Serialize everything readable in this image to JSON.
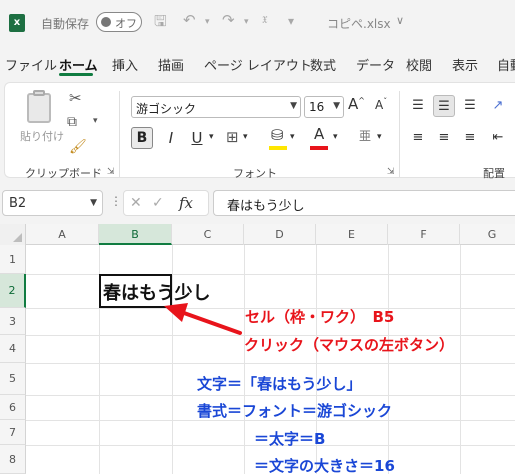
{
  "titlebar": {
    "autosave_label": "自動保存",
    "toggle_state": "オフ",
    "filename": "コピペ.xlsx",
    "filename_chevron": "∨"
  },
  "tabs": [
    "ファイル",
    "ホーム",
    "挿入",
    "描画",
    "ページ レイアウト",
    "数式",
    "データ",
    "校閲",
    "表示",
    "自動"
  ],
  "active_tab": "ホーム",
  "ribbon": {
    "clipboard": {
      "paste_label": "貼り付け",
      "group_label": "クリップボード"
    },
    "font": {
      "font_name": "游ゴシック",
      "font_size": "16",
      "bold_label": "B",
      "italic_label": "I",
      "underline_label": "U",
      "grow_label": "A",
      "shrink_label": "A",
      "font_color_label": "A",
      "phonetic_label": "亜",
      "group_label": "フォント"
    },
    "alignment": {
      "group_label": "配置"
    }
  },
  "formula_bar": {
    "name_box": "B2",
    "fx_label": "fx",
    "formula": "春はもう少し"
  },
  "grid": {
    "columns": [
      "A",
      "B",
      "C",
      "D",
      "E",
      "F",
      "G"
    ],
    "rows": [
      "1",
      "2",
      "3",
      "4",
      "5",
      "6",
      "7",
      "8"
    ],
    "selected_column": "B",
    "selected_row": "2",
    "cell_b2": "春はもう少し"
  },
  "annotations": {
    "red_line1": "セル（枠・ワク）　B5",
    "red_line2": "クリック（マウスの左ボタン）",
    "blue_line1": "文字＝「春はもう少し」",
    "blue_line2": "書式＝フォント＝游ゴシック",
    "blue_line3": "＝太字＝B",
    "blue_line4": "＝文字の大きさ＝16",
    "red_color": "#e8141b",
    "blue_color": "#1a47d6"
  },
  "colors": {
    "accent": "#107c41",
    "titlebar_bg": "#f3f3f3"
  }
}
